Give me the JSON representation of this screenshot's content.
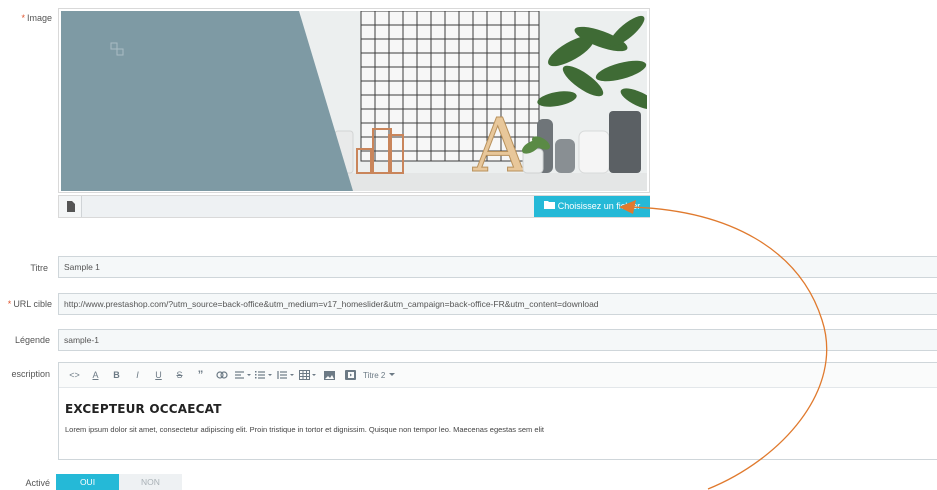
{
  "labels": {
    "required_mark": "*",
    "image": "Image",
    "title": "Titre",
    "url": "URL cible",
    "caption": "Légende",
    "description": "escription",
    "active": "Activé"
  },
  "image_upload": {
    "choose_label": "Choisissez un fichier",
    "preview_letter": "A"
  },
  "fields": {
    "title_value": "Sample 1",
    "url_value": "http://www.prestashop.com/?utm_source=back-office&utm_medium=v17_homeslider&utm_campaign=back-office-FR&utm_content=download",
    "caption_value": "sample-1"
  },
  "editor": {
    "toolbar": {
      "code": "<>",
      "font_color": "A",
      "bold": "B",
      "italic": "I",
      "underline": "U",
      "strike": "S",
      "quote": "”",
      "heading_style": "Titre 2"
    },
    "heading": "EXCEPTEUR OCCAECAT",
    "paragraph": "Lorem ipsum dolor sit amet, consectetur adipiscing elit. Proin tristique in tortor et dignissim. Quisque non tempor leo. Maecenas egestas sem elit"
  },
  "active_toggle": {
    "on_label": "OUI",
    "off_label": "NON",
    "value": "OUI"
  },
  "colors": {
    "accent": "#25b9d7",
    "required": "#e0542e",
    "annotation_arrow": "#e07a2e",
    "preview_panel": "#7e9aa4"
  }
}
